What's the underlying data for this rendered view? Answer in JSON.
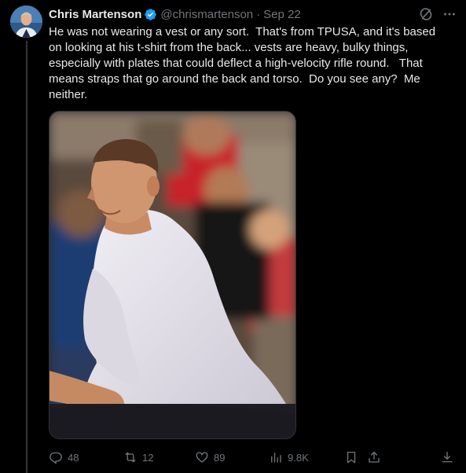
{
  "author": {
    "name": "Chris Martenson",
    "handle": "@chrismartenson",
    "separator": "·",
    "date": "Sep 22"
  },
  "tweet": {
    "text": "He was not wearing a vest or any sort.  That's from TPUSA, and it's based on looking at his t-shirt from the back... vests are heavy, bulky things, especially with plates that could deflect a high-velocity rifle round.   That means straps that go around the back and torso.  Do you see any?  Me neither."
  },
  "stats": {
    "replies": "48",
    "reposts": "12",
    "likes": "89",
    "views": "9.8K"
  },
  "icons": {
    "verified": "verified-badge-icon",
    "grok": "grok-icon",
    "more": "more-icon",
    "reply": "reply-icon",
    "repost": "repost-icon",
    "like": "heart-icon",
    "views": "views-icon",
    "bookmark": "bookmark-icon",
    "share": "share-icon",
    "download": "download-icon"
  },
  "colors": {
    "background": "#000000",
    "text": "#e7e9ea",
    "muted": "#71767b",
    "verified": "#1d9bf0"
  }
}
